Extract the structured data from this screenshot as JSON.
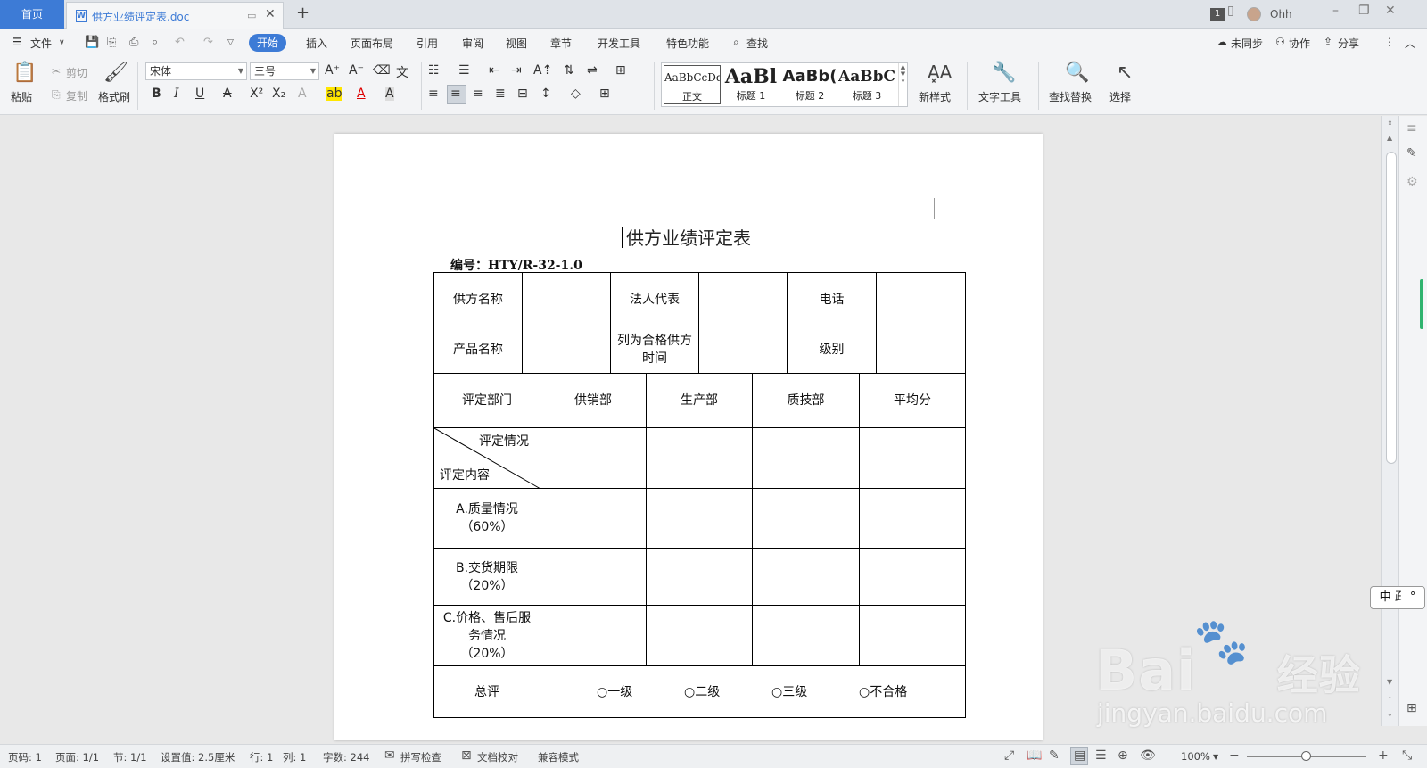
{
  "titlebar": {
    "home_tab": "首页",
    "doc_tab": "供方业绩评定表.doc",
    "doc_icon": "W",
    "page_badge": "1",
    "user_name": "Ohh",
    "new_tab": "+"
  },
  "menubar": {
    "file": "文件",
    "items": [
      "开始",
      "插入",
      "页面布局",
      "引用",
      "审阅",
      "视图",
      "章节",
      "开发工具",
      "特色功能",
      "查找"
    ],
    "sync": "未同步",
    "collab": "协作",
    "share": "分享"
  },
  "ribbon": {
    "paste": "粘贴",
    "cut": "剪切",
    "copy": "复制",
    "format_painter": "格式刷",
    "font_name": "宋体",
    "font_size": "三号",
    "styles": [
      {
        "preview": "AaBbCcDd",
        "label": "正文"
      },
      {
        "preview": "AaBl",
        "label": "标题 1"
      },
      {
        "preview": "AaBb(",
        "label": "标题 2"
      },
      {
        "preview": "AaBbC",
        "label": "标题 3"
      }
    ],
    "new_style": "新样式",
    "text_tools": "文字工具",
    "find_replace": "查找替换",
    "select": "选择"
  },
  "document": {
    "title": "供方业绩评定表",
    "code": "编号：HTY/R-32-1.0",
    "table": {
      "row1": [
        "供方名称",
        "",
        "法人代表",
        "",
        "电话",
        ""
      ],
      "row2": [
        "产品名称",
        "",
        "列为合格供方时间",
        "",
        "级别",
        ""
      ],
      "header": [
        "评定部门",
        "供销部",
        "生产部",
        "质技部",
        "平均分"
      ],
      "diag_top": "评定情况",
      "diag_bottom": "评定内容",
      "criteria": [
        {
          "name": "A.质量情况",
          "weight": "（60%）"
        },
        {
          "name": "B.交货期限",
          "weight": "（20%）"
        },
        {
          "name": "C.价格、售后服务情况",
          "weight": "（20%）"
        }
      ],
      "summary_label": "总评",
      "grades": [
        "○一级",
        "○二级",
        "○三级",
        "○不合格"
      ]
    }
  },
  "ime": "中 ⺪ °",
  "watermark": {
    "big": "Bai",
    "big2": "经验",
    "small": "jingyan.baidu.com"
  },
  "statusbar": {
    "page_no": "页码: 1",
    "pages": "页面: 1/1",
    "section": "节: 1/1",
    "setting": "设置值: 2.5厘米",
    "row": "行: 1",
    "col": "列: 1",
    "word_count": "字数: 244",
    "spell_check": "拼写检查",
    "doc_proof": "文档校对",
    "compat": "兼容模式",
    "zoom": "100%"
  }
}
